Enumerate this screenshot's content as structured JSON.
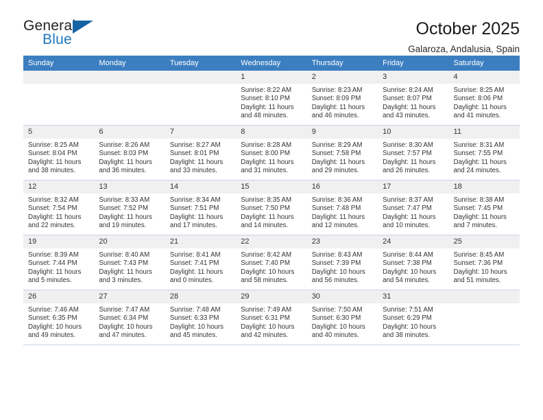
{
  "brand": {
    "name_part1": "General",
    "name_part2": "Blue",
    "triangle_color": "#1763a6",
    "blue_color": "#2176bd"
  },
  "header": {
    "title": "October 2025",
    "subtitle": "Galaroza, Andalusia, Spain"
  },
  "theme": {
    "header_bar_color": "#3c7fc1",
    "daynum_bg": "#f0f0f0",
    "grid_line": "#c8d4e2"
  },
  "weekdays": [
    "Sunday",
    "Monday",
    "Tuesday",
    "Wednesday",
    "Thursday",
    "Friday",
    "Saturday"
  ],
  "weeks": [
    [
      {
        "day": "",
        "details": ""
      },
      {
        "day": "",
        "details": ""
      },
      {
        "day": "",
        "details": ""
      },
      {
        "day": "1",
        "details": "Sunrise: 8:22 AM\nSunset: 8:10 PM\nDaylight: 11 hours\nand 48 minutes."
      },
      {
        "day": "2",
        "details": "Sunrise: 8:23 AM\nSunset: 8:09 PM\nDaylight: 11 hours\nand 46 minutes."
      },
      {
        "day": "3",
        "details": "Sunrise: 8:24 AM\nSunset: 8:07 PM\nDaylight: 11 hours\nand 43 minutes."
      },
      {
        "day": "4",
        "details": "Sunrise: 8:25 AM\nSunset: 8:06 PM\nDaylight: 11 hours\nand 41 minutes."
      }
    ],
    [
      {
        "day": "5",
        "details": "Sunrise: 8:25 AM\nSunset: 8:04 PM\nDaylight: 11 hours\nand 38 minutes."
      },
      {
        "day": "6",
        "details": "Sunrise: 8:26 AM\nSunset: 8:03 PM\nDaylight: 11 hours\nand 36 minutes."
      },
      {
        "day": "7",
        "details": "Sunrise: 8:27 AM\nSunset: 8:01 PM\nDaylight: 11 hours\nand 33 minutes."
      },
      {
        "day": "8",
        "details": "Sunrise: 8:28 AM\nSunset: 8:00 PM\nDaylight: 11 hours\nand 31 minutes."
      },
      {
        "day": "9",
        "details": "Sunrise: 8:29 AM\nSunset: 7:58 PM\nDaylight: 11 hours\nand 29 minutes."
      },
      {
        "day": "10",
        "details": "Sunrise: 8:30 AM\nSunset: 7:57 PM\nDaylight: 11 hours\nand 26 minutes."
      },
      {
        "day": "11",
        "details": "Sunrise: 8:31 AM\nSunset: 7:55 PM\nDaylight: 11 hours\nand 24 minutes."
      }
    ],
    [
      {
        "day": "12",
        "details": "Sunrise: 8:32 AM\nSunset: 7:54 PM\nDaylight: 11 hours\nand 22 minutes."
      },
      {
        "day": "13",
        "details": "Sunrise: 8:33 AM\nSunset: 7:52 PM\nDaylight: 11 hours\nand 19 minutes."
      },
      {
        "day": "14",
        "details": "Sunrise: 8:34 AM\nSunset: 7:51 PM\nDaylight: 11 hours\nand 17 minutes."
      },
      {
        "day": "15",
        "details": "Sunrise: 8:35 AM\nSunset: 7:50 PM\nDaylight: 11 hours\nand 14 minutes."
      },
      {
        "day": "16",
        "details": "Sunrise: 8:36 AM\nSunset: 7:48 PM\nDaylight: 11 hours\nand 12 minutes."
      },
      {
        "day": "17",
        "details": "Sunrise: 8:37 AM\nSunset: 7:47 PM\nDaylight: 11 hours\nand 10 minutes."
      },
      {
        "day": "18",
        "details": "Sunrise: 8:38 AM\nSunset: 7:45 PM\nDaylight: 11 hours\nand 7 minutes."
      }
    ],
    [
      {
        "day": "19",
        "details": "Sunrise: 8:39 AM\nSunset: 7:44 PM\nDaylight: 11 hours\nand 5 minutes."
      },
      {
        "day": "20",
        "details": "Sunrise: 8:40 AM\nSunset: 7:43 PM\nDaylight: 11 hours\nand 3 minutes."
      },
      {
        "day": "21",
        "details": "Sunrise: 8:41 AM\nSunset: 7:41 PM\nDaylight: 11 hours\nand 0 minutes."
      },
      {
        "day": "22",
        "details": "Sunrise: 8:42 AM\nSunset: 7:40 PM\nDaylight: 10 hours\nand 58 minutes."
      },
      {
        "day": "23",
        "details": "Sunrise: 8:43 AM\nSunset: 7:39 PM\nDaylight: 10 hours\nand 56 minutes."
      },
      {
        "day": "24",
        "details": "Sunrise: 8:44 AM\nSunset: 7:38 PM\nDaylight: 10 hours\nand 54 minutes."
      },
      {
        "day": "25",
        "details": "Sunrise: 8:45 AM\nSunset: 7:36 PM\nDaylight: 10 hours\nand 51 minutes."
      }
    ],
    [
      {
        "day": "26",
        "details": "Sunrise: 7:46 AM\nSunset: 6:35 PM\nDaylight: 10 hours\nand 49 minutes."
      },
      {
        "day": "27",
        "details": "Sunrise: 7:47 AM\nSunset: 6:34 PM\nDaylight: 10 hours\nand 47 minutes."
      },
      {
        "day": "28",
        "details": "Sunrise: 7:48 AM\nSunset: 6:33 PM\nDaylight: 10 hours\nand 45 minutes."
      },
      {
        "day": "29",
        "details": "Sunrise: 7:49 AM\nSunset: 6:31 PM\nDaylight: 10 hours\nand 42 minutes."
      },
      {
        "day": "30",
        "details": "Sunrise: 7:50 AM\nSunset: 6:30 PM\nDaylight: 10 hours\nand 40 minutes."
      },
      {
        "day": "31",
        "details": "Sunrise: 7:51 AM\nSunset: 6:29 PM\nDaylight: 10 hours\nand 38 minutes."
      },
      {
        "day": "",
        "details": ""
      }
    ]
  ]
}
